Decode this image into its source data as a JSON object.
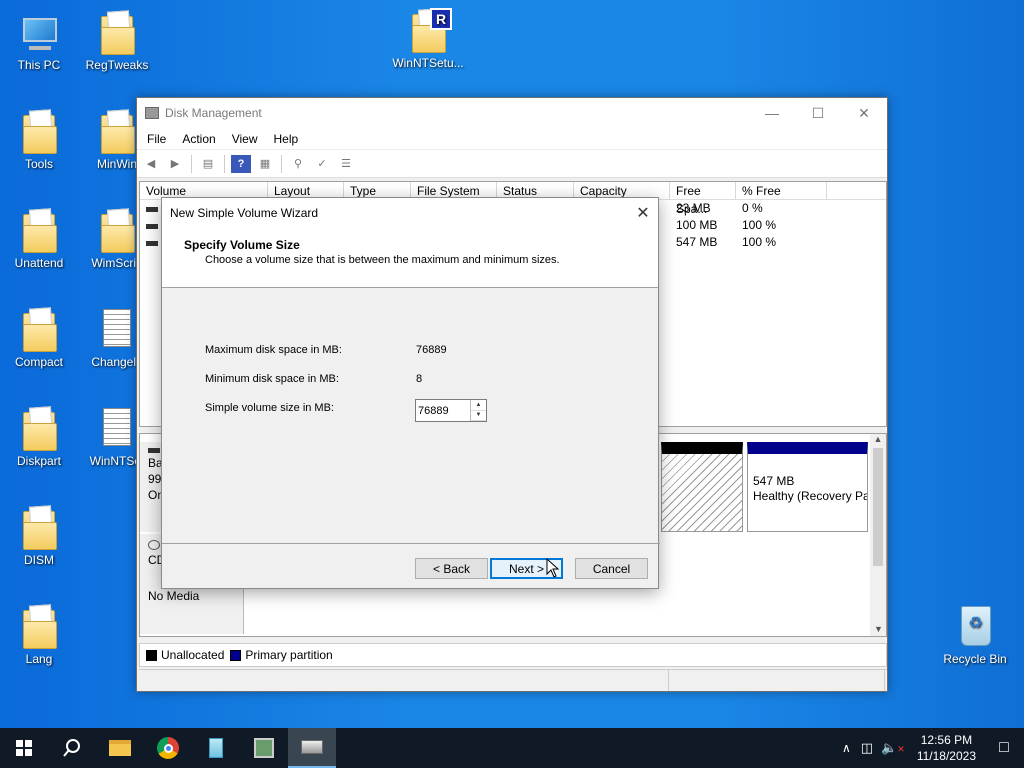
{
  "desktop": {
    "icons": [
      {
        "label": "This PC",
        "icon": "this-pc-icon"
      },
      {
        "label": "RegTweaks",
        "icon": "folder-icon"
      },
      {
        "label": "WinNTSetu...",
        "icon": "winntsetup-icon"
      },
      {
        "label": "Tools",
        "icon": "folder-icon"
      },
      {
        "label": "MinWin",
        "icon": "folder-icon"
      },
      {
        "label": "Unattend",
        "icon": "folder-icon"
      },
      {
        "label": "WimScrip",
        "icon": "folder-icon"
      },
      {
        "label": "Compact",
        "icon": "folder-icon"
      },
      {
        "label": "Changelo",
        "icon": "document-icon"
      },
      {
        "label": "Diskpart",
        "icon": "folder-icon"
      },
      {
        "label": "WinNTSet",
        "icon": "document-icon"
      },
      {
        "label": "DISM",
        "icon": "folder-icon"
      },
      {
        "label": "Lang",
        "icon": "folder-icon"
      },
      {
        "label": "Recycle Bin",
        "icon": "recycle-bin-icon"
      }
    ]
  },
  "disk_mgmt": {
    "title": "Disk Management",
    "menu": [
      "File",
      "Action",
      "View",
      "Help"
    ],
    "columns": [
      "Volume",
      "Layout",
      "Type",
      "File System",
      "Status",
      "Capacity",
      "Free Spa...",
      "% Free"
    ],
    "rows": [
      {
        "free": "23 MB",
        "pct": "0 %"
      },
      {
        "free": "100 MB",
        "pct": "100 %"
      },
      {
        "free": "547 MB",
        "pct": "100 %"
      }
    ],
    "disk0": {
      "label1": "Ba",
      "label2": "99.",
      "label3": "On"
    },
    "disk1": {
      "label1": "CD",
      "media": "No Media"
    },
    "recovery": {
      "size": "547 MB",
      "status": "Healthy (Recovery Pa"
    },
    "legend": {
      "unallocated": "Unallocated",
      "primary": "Primary partition",
      "unallocated_color": "#000000",
      "primary_color": "#00008b"
    }
  },
  "wizard": {
    "title": "New Simple Volume Wizard",
    "heading": "Specify Volume Size",
    "subheading": "Choose a volume size that is between the maximum and minimum sizes.",
    "max_label": "Maximum disk space in MB:",
    "max_value": "76889",
    "min_label": "Minimum disk space in MB:",
    "min_value": "8",
    "size_label": "Simple volume size in MB:",
    "size_value": "76889",
    "back": "< Back",
    "next": "Next >",
    "cancel": "Cancel"
  },
  "taskbar": {
    "time": "12:56 PM",
    "date": "11/18/2023"
  },
  "colors": {
    "accent": "#0078d7",
    "desktop": "#1a86e6",
    "taskbar": "#101a26"
  }
}
